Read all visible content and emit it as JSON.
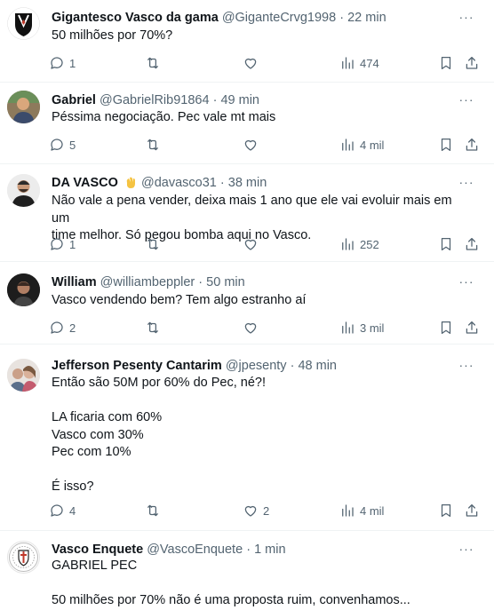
{
  "tweets": [
    {
      "name": "Gigantesco Vasco da gama",
      "handle": "@GiganteCrvg1998",
      "time": "22 min",
      "lines": [
        "50 milhões por 70%?"
      ],
      "replies": "1",
      "reposts": "",
      "likes": "",
      "views": "474"
    },
    {
      "name": "Gabriel",
      "handle": "@GabrielRib91864",
      "time": "49 min",
      "lines": [
        "Péssima negociação. Pec vale mt mais"
      ],
      "replies": "5",
      "reposts": "",
      "likes": "",
      "views": "4 mil"
    },
    {
      "name": "DA VASCO",
      "handle": "@davasco31",
      "time": "38 min",
      "lines": [
        "Não vale a pena vender, deixa mais 1 ano que ele vai evoluir mais em um",
        "time melhor. Só pegou bomba aqui no Vasco."
      ],
      "replies": "1",
      "reposts": "",
      "likes": "",
      "views": "252"
    },
    {
      "name": "William",
      "handle": "@williambeppler",
      "time": "50 min",
      "lines": [
        "Vasco vendendo bem? Tem algo estranho aí"
      ],
      "replies": "2",
      "reposts": "",
      "likes": "",
      "views": "3 mil"
    },
    {
      "name": "Jefferson Pesenty Cantarim",
      "handle": "@jpesenty",
      "time": "48 min",
      "lines": [
        "Então são 50M por 60% do Pec, né?!",
        "",
        "LA ficaria com 60%",
        "Vasco com 30%",
        "Pec com 10%",
        "",
        "É isso?"
      ],
      "replies": "4",
      "reposts": "",
      "likes": "2",
      "views": "4 mil"
    },
    {
      "name": "Vasco Enquete",
      "handle": "@VascoEnquete",
      "time": "1 min",
      "lines": [
        "GABRIEL PEC",
        "",
        "50 milhões por 70% não é uma proposta ruim, convenhamos..."
      ],
      "replies": "",
      "reposts": "",
      "likes": "",
      "views": ""
    }
  ],
  "ui": {
    "dot": "·",
    "more": "···"
  }
}
